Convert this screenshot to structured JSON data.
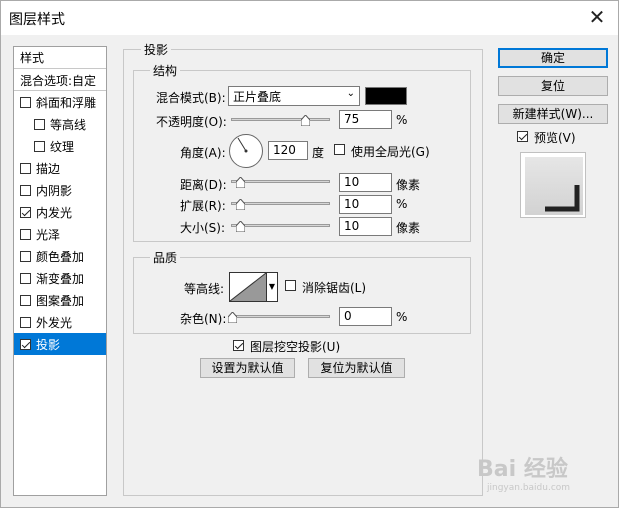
{
  "window": {
    "title": "图层样式",
    "close_glyph": "✕"
  },
  "sidebar": {
    "header": "样式",
    "blend_options": "混合选项:自定",
    "items": [
      {
        "label": "斜面和浮雕",
        "checked": false,
        "sub": false
      },
      {
        "label": "等高线",
        "checked": false,
        "sub": true
      },
      {
        "label": "纹理",
        "checked": false,
        "sub": true
      },
      {
        "label": "描边",
        "checked": false,
        "sub": false
      },
      {
        "label": "内阴影",
        "checked": false,
        "sub": false
      },
      {
        "label": "内发光",
        "checked": true,
        "sub": false
      },
      {
        "label": "光泽",
        "checked": false,
        "sub": false
      },
      {
        "label": "颜色叠加",
        "checked": false,
        "sub": false
      },
      {
        "label": "渐变叠加",
        "checked": false,
        "sub": false
      },
      {
        "label": "图案叠加",
        "checked": false,
        "sub": false
      },
      {
        "label": "外发光",
        "checked": false,
        "sub": false
      },
      {
        "label": "投影",
        "checked": true,
        "sub": false,
        "selected": true
      }
    ]
  },
  "drop_shadow": {
    "title": "投影",
    "structure": {
      "title": "结构",
      "blend_mode_label": "混合模式(B):",
      "blend_mode_value": "正片叠底",
      "shadow_color": "#000000",
      "opacity_label": "不透明度(O):",
      "opacity_value": "75",
      "opacity_unit": "%",
      "angle_label": "角度(A):",
      "angle_value": "120",
      "angle_unit": "度",
      "global_light_label": "使用全局光(G)",
      "global_light_checked": false,
      "distance_label": "距离(D):",
      "distance_value": "10",
      "distance_unit": "像素",
      "spread_label": "扩展(R):",
      "spread_value": "10",
      "spread_unit": "%",
      "size_label": "大小(S):",
      "size_value": "10",
      "size_unit": "像素"
    },
    "quality": {
      "title": "品质",
      "contour_label": "等高线:",
      "antialias_label": "消除锯齿(L)",
      "antialias_checked": false,
      "noise_label": "杂色(N):",
      "noise_value": "0",
      "noise_unit": "%"
    },
    "knockout_label": "图层挖空投影(U)",
    "knockout_checked": true,
    "make_default": "设置为默认值",
    "reset_default": "复位为默认值"
  },
  "buttons": {
    "ok": "确定",
    "reset": "复位",
    "new_style": "新建样式(W)...",
    "preview_label": "预览(V)",
    "preview_checked": true
  },
  "watermark": {
    "text": "Bai 经验",
    "sub": "jingyan.baidu.com"
  }
}
